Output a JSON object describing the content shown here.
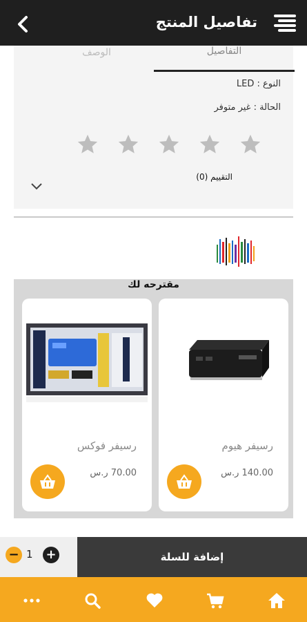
{
  "header": {
    "title": "تفاصيل المنتج",
    "back_icon": "back-chevron-icon",
    "menu_icon": "menu-icon",
    "background": "#1f1f1f"
  },
  "details": {
    "tabs": [
      {
        "label": "التفاصيل",
        "active": true
      },
      {
        "label": "الوصف",
        "active": false
      }
    ],
    "type_line": "النوع : LED",
    "status_line": "الحالة : غير متوفر",
    "stars_filled": 0,
    "stars_total": 5,
    "rating_text": "التقييم (0)"
  },
  "suggested": {
    "title": "مقترحه لك",
    "products": [
      {
        "name": "رسيفر هيوم",
        "price": "140.00 ر.س"
      },
      {
        "name": "رسيفر فوكس",
        "price": "70.00 ر.س"
      }
    ]
  },
  "cart": {
    "quantity": "1",
    "minus": "−",
    "plus": "+",
    "add_label": "إضافة للسلة"
  },
  "nav": {
    "items": [
      "home-icon",
      "cart-icon",
      "heart-icon",
      "search-icon",
      "more-icon"
    ],
    "accent": "#f5a81f"
  }
}
